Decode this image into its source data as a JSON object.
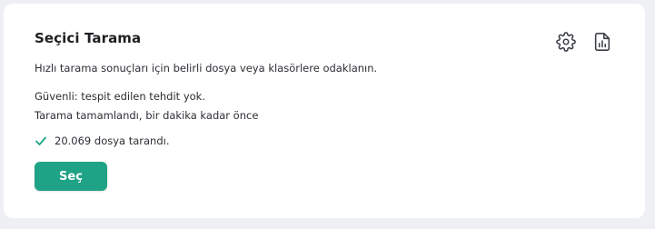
{
  "card": {
    "title": "Seçici Tarama",
    "description": "Hızlı tarama sonuçları için belirli dosya veya klasörlere odaklanın.",
    "status_safe": "Güvenli: tespit edilen tehdit yok.",
    "status_completed": "Tarama tamamlandı, bir dakika kadar önce",
    "files_scanned": "20.069 dosya tarandı.",
    "select_button_label": "Seç"
  },
  "icons": {
    "settings": "gear-icon",
    "report": "report-icon",
    "check": "check-icon"
  },
  "colors": {
    "accent": "#1fa386",
    "check": "#1fa386",
    "card_background": "#ffffff",
    "page_background": "#eef0f3"
  }
}
